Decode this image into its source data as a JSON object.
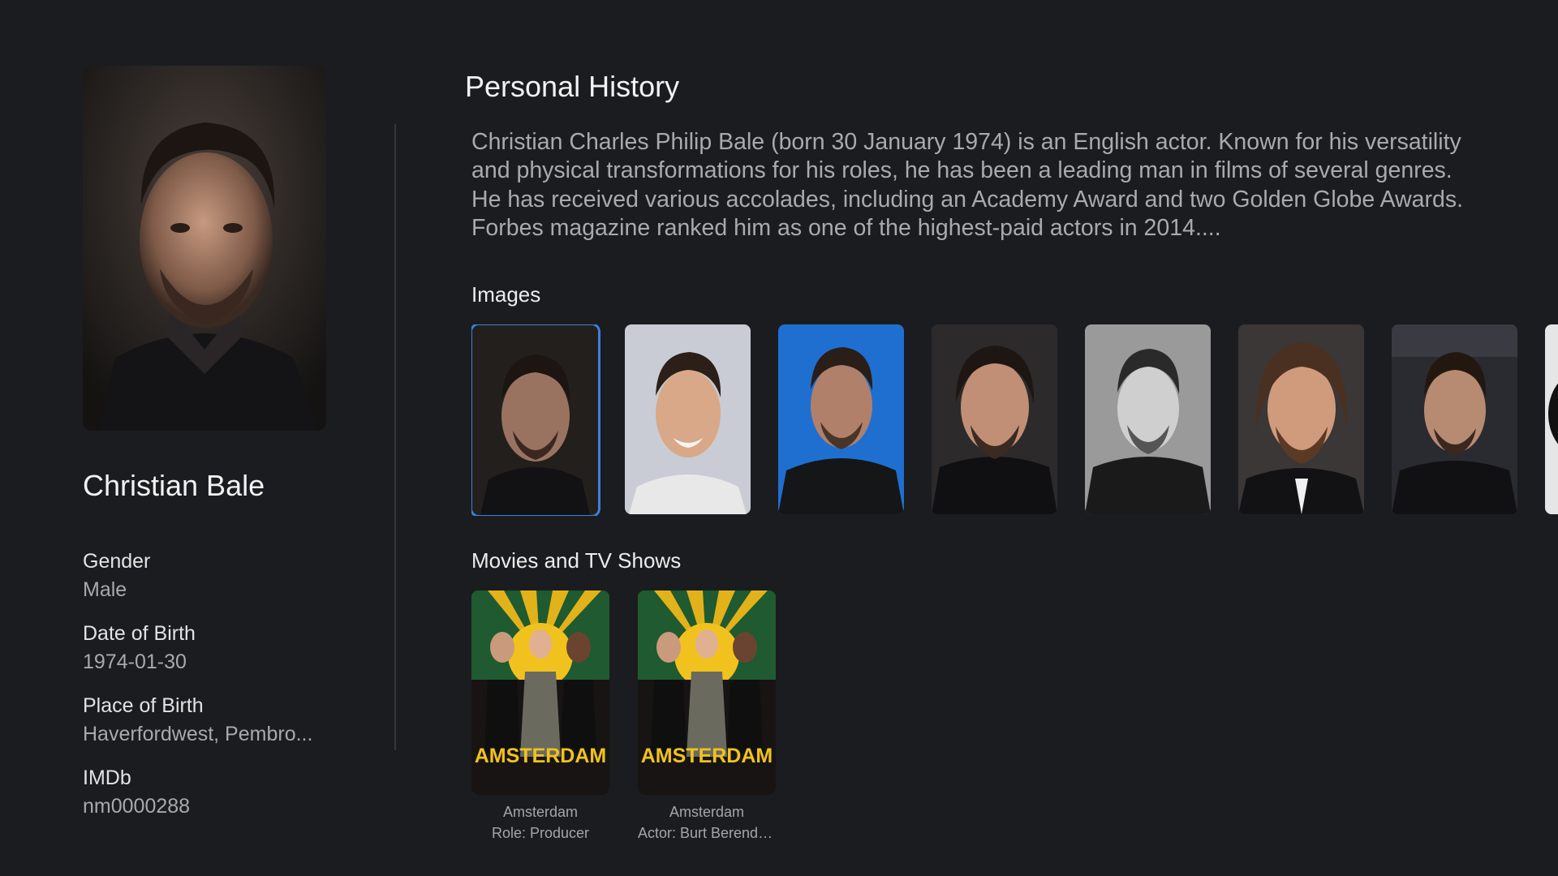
{
  "person": {
    "name": "Christian Bale",
    "facts": [
      {
        "label": "Gender",
        "value": "Male"
      },
      {
        "label": "Date of Birth",
        "value": "1974-01-30"
      },
      {
        "label": "Place of Birth",
        "value": "Haverfordwest, Pembro..."
      },
      {
        "label": "IMDb",
        "value": "nm0000288"
      }
    ]
  },
  "history": {
    "title": "Personal History",
    "bio": "Christian Charles Philip Bale (born 30 January 1974) is an English actor. Known for his versatility and physical transformations for his roles, he has been a leading man in films of several genres. He has received various accolades, including an Academy Award and two Golden Globe Awards. Forbes magazine ranked him as one of the highest-paid actors in 2014...."
  },
  "images": {
    "title": "Images",
    "focused_index": 0
  },
  "movies": {
    "title": "Movies and TV Shows",
    "items": [
      {
        "poster_text": "AMSTERDAM",
        "title": "Amsterdam",
        "role": "Role: Producer"
      },
      {
        "poster_text": "AMSTERDAM",
        "title": "Amsterdam",
        "role": "Actor: Burt Berends..."
      }
    ]
  },
  "colors": {
    "background": "#1b1c1f",
    "focus_ring": "#3d7fe0",
    "text_primary": "#f2f2f2",
    "text_secondary": "#a9aaad"
  }
}
